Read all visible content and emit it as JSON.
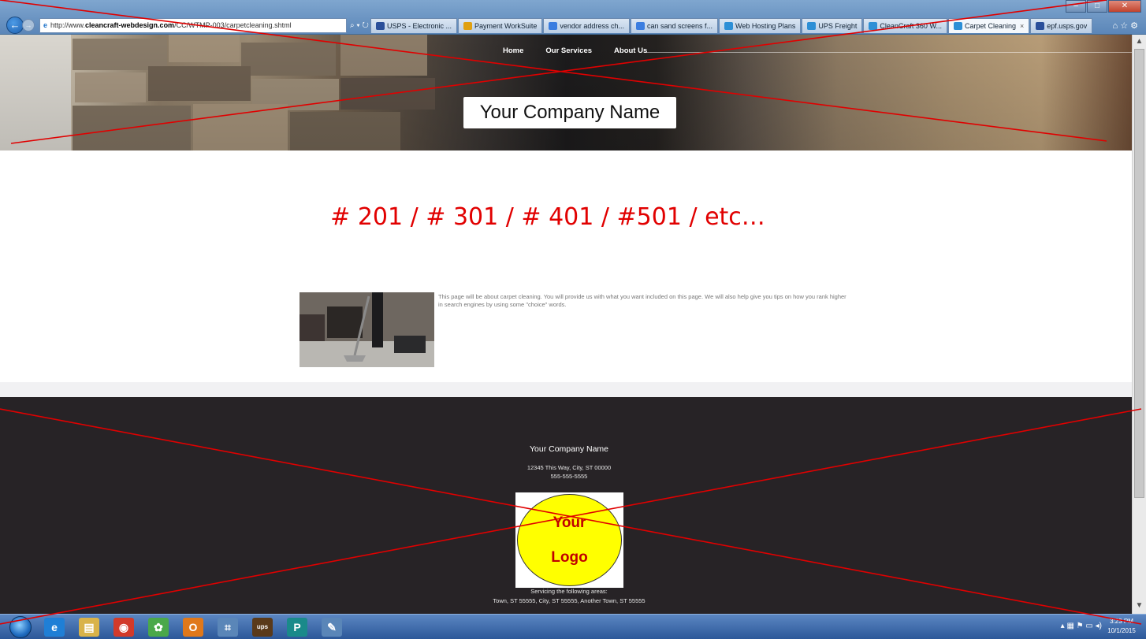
{
  "browser": {
    "window_buttons": [
      "–",
      "□",
      "✕"
    ],
    "url_prefix": "http://www.",
    "url_domain": "cleancraft-webdesign.com",
    "url_path": "/CC/WTMP-003/carpetcleaning.shtml",
    "url_controls": "⌕ ▾ ↻",
    "tabs": [
      {
        "label": "USPS - Electronic ...",
        "color": "#2a4f9a",
        "active": false
      },
      {
        "label": "Payment WorkSuite",
        "color": "#e0a010",
        "active": false
      },
      {
        "label": "vendor address ch...",
        "color": "#3a7de0",
        "active": false
      },
      {
        "label": "can sand screens f...",
        "color": "#3a7de0",
        "active": false
      },
      {
        "label": "Web Hosting Plans",
        "color": "#2d8fd6",
        "active": false
      },
      {
        "label": "UPS Freight",
        "color": "#2d8fd6",
        "active": false
      },
      {
        "label": "CleanCraft 360 W...",
        "color": "#2d8fd6",
        "active": false
      },
      {
        "label": "Carpet Cleaning",
        "color": "#2d8fd6",
        "active": true
      },
      {
        "label": "epf.usps.gov",
        "color": "#2a4f9a",
        "active": false
      }
    ],
    "right_controls": "⌂ ☆ ⚙"
  },
  "site": {
    "nav": [
      "Home",
      "Our Services",
      "About Us"
    ],
    "company_name": "Your Company Name",
    "headline": "# 201 / # 301 / # 401 / #501 / etc…",
    "body_text": "This page will be about carpet cleaning. You will provide us with what you want included on this page. We will also help give you tips on how you rank higher in search engines by using some \"choice\" words.",
    "footer": {
      "company_name": "Your Company Name",
      "address": "12345 This Way, City, ST 00000",
      "phone": "555-555-5555",
      "logo_line1": "Your",
      "logo_line2": "Logo",
      "servicing_heading": "Servicing the following areas:",
      "servicing_list": "Town, ST 55555, City, ST 55555, Another Town, ST 55555"
    }
  },
  "taskbar": {
    "icons": [
      {
        "name": "internet-explorer-icon",
        "glyph": "e",
        "color": "#1f7fd6"
      },
      {
        "name": "file-explorer-icon",
        "glyph": "▤",
        "color": "#d9b34a"
      },
      {
        "name": "chrome-icon",
        "glyph": "◉",
        "color": "#d23a2a"
      },
      {
        "name": "app-green-icon",
        "glyph": "✿",
        "color": "#4aa84a"
      },
      {
        "name": "outlook-icon",
        "glyph": "O",
        "color": "#e0781a"
      },
      {
        "name": "network-icon",
        "glyph": "⌗",
        "color": "#5a86b8"
      },
      {
        "name": "ups-icon",
        "glyph": "ups",
        "color": "#5a3a1a"
      },
      {
        "name": "publisher-icon",
        "glyph": "P",
        "color": "#1a8a8a"
      },
      {
        "name": "paint-icon",
        "glyph": "✎",
        "color": "#5a86b8"
      }
    ],
    "tray": "▴ ▦ ⚑ ▭ ◂)",
    "time": "3:23 PM",
    "date": "10/1/2015"
  },
  "colors": {
    "headline": "#e10000",
    "footer_bg": "#272326",
    "logo_fill": "#ffff00",
    "logo_text": "#c00000",
    "cross_lines": "#e00000"
  }
}
